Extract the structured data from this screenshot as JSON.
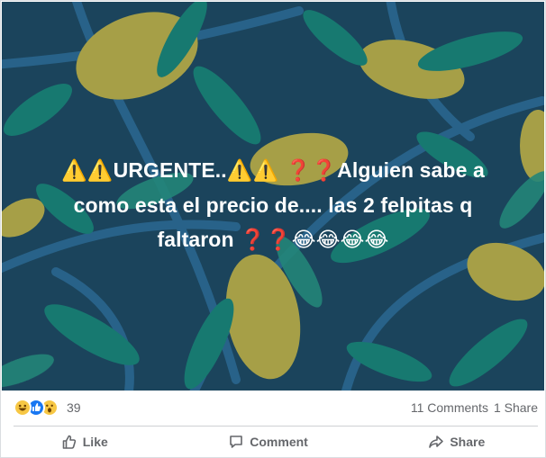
{
  "post": {
    "text_line1_a": "URGENTE..",
    "text_line1_b": "Alguien sabe a",
    "text_line2": "como esta el precio de.... las 2 felpitas q",
    "text_line3": "faltaron",
    "background_color": "#1f4a63"
  },
  "reactions": {
    "types": [
      "haha",
      "like",
      "wow"
    ],
    "count": "39"
  },
  "stats": {
    "comments": "11 Comments",
    "shares": "1 Share"
  },
  "actions": {
    "like_label": "Like",
    "comment_label": "Comment",
    "share_label": "Share"
  }
}
